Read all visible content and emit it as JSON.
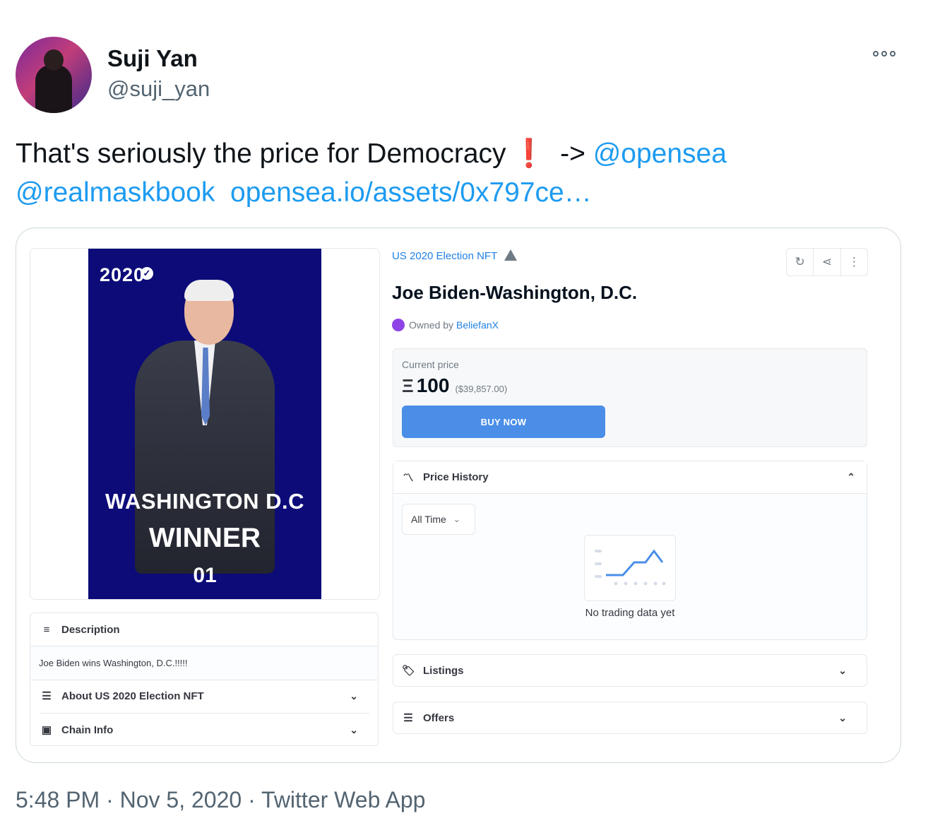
{
  "tweet": {
    "author_name": "Suji Yan",
    "author_handle": "@suji_yan",
    "text_main": "That's seriously the price for Democracy",
    "bang": "❗",
    "arrow": "->",
    "mention1": "@opensea",
    "mention2": "@realmaskbook",
    "link": "opensea.io/assets/0x797ce…",
    "footer": "5:48 PM · Nov 5, 2020 · Twitter Web App"
  },
  "nft": {
    "year_text": "2020",
    "line1": "WASHINGTON D.C",
    "line2": "WINNER",
    "line3": "01"
  },
  "listing": {
    "collection": "US 2020 Election NFT",
    "title": "Joe Biden-Washington, D.C.",
    "owned_prefix": "Owned by",
    "owner": "BeliefanX",
    "price_label": "Current price",
    "eth_symbol": "Ξ",
    "price": "100",
    "price_usd": "($39,857.00)",
    "buy_label": "BUY NOW",
    "price_history_label": "Price History",
    "time_filter": "All Time",
    "no_data": "No trading data yet",
    "listings_label": "Listings",
    "offers_label": "Offers",
    "description_label": "Description",
    "description_text": "Joe Biden wins Washington, D.C.!!!!!",
    "about_label": "About US 2020 Election NFT",
    "chain_label": "Chain Info"
  }
}
